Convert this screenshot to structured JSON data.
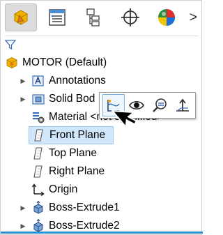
{
  "tabs": [
    {
      "name": "featuremanager",
      "icon": "featuremanager-tree-icon",
      "active": true
    },
    {
      "name": "propertymanager",
      "icon": "propertymanager-icon",
      "active": false
    },
    {
      "name": "configurationmanager",
      "icon": "configurationmanager-icon",
      "active": false
    },
    {
      "name": "dimxpertmanager",
      "icon": "dimxpert-crosshair-icon",
      "active": false
    },
    {
      "name": "displaymanager",
      "icon": "displaymanager-sphere-icon",
      "active": false
    }
  ],
  "tabs_more": ">",
  "filter_icon": "filter-funnel-icon",
  "tree": {
    "root_label": "MOTOR  (Default)",
    "items": [
      {
        "label": "Annotations",
        "icon": "annotations-icon",
        "expandable": true
      },
      {
        "label": "Solid Bod",
        "icon": "solid-bodies-folder-icon",
        "expandable": true
      },
      {
        "label": "Material <not specified>",
        "icon": "material-icon",
        "expandable": false
      },
      {
        "label": "Front Plane",
        "icon": "plane-icon",
        "expandable": false,
        "selected": true
      },
      {
        "label": "Top Plane",
        "icon": "plane-icon",
        "expandable": false
      },
      {
        "label": "Right Plane",
        "icon": "plane-icon",
        "expandable": false
      },
      {
        "label": "Origin",
        "icon": "origin-icon",
        "expandable": false
      },
      {
        "label": "Boss-Extrude1",
        "icon": "boss-extrude-icon",
        "expandable": true
      },
      {
        "label": "Boss-Extrude2",
        "icon": "boss-extrude-icon",
        "expandable": true
      }
    ]
  },
  "context_toolbar": {
    "buttons": [
      {
        "name": "sketch-button",
        "icon": "sketch-icon"
      },
      {
        "name": "show-hide-button",
        "icon": "eye-icon"
      },
      {
        "name": "zoom-to-selection-button",
        "icon": "zoom-selection-icon"
      },
      {
        "name": "normal-to-button",
        "icon": "normal-to-icon"
      }
    ]
  },
  "colors": {
    "selection_bg": "#cfe6fb",
    "selection_border": "#9cc7ef",
    "accent_blue": "#2e8fd6",
    "part_yellow": "#f0b400",
    "part_orange": "#e07a1f"
  }
}
